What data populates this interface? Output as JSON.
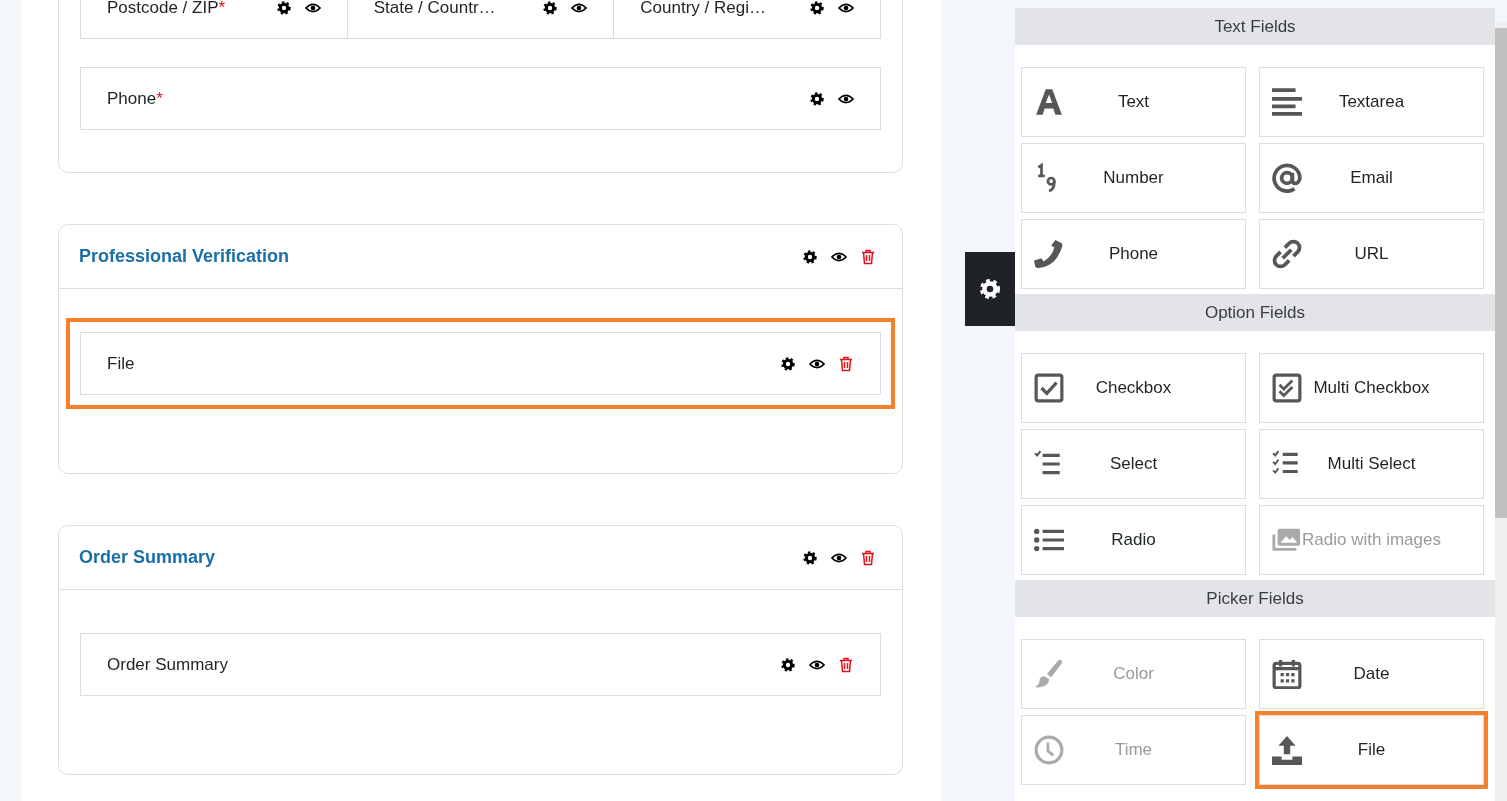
{
  "sections": [
    {
      "rows": [
        {
          "highlighted": false,
          "fields": [
            {
              "label": "Postcode / ZIP",
              "required_mark": "*"
            },
            {
              "label": "State / Countr…"
            },
            {
              "label": "Country / Regi…"
            }
          ]
        },
        {
          "highlighted": false,
          "fields": [
            {
              "label": "Phone",
              "required_mark": "*"
            }
          ]
        }
      ]
    },
    {
      "title": "Professional Verification",
      "deletable": true,
      "rows": [
        {
          "highlighted": true,
          "fields": [
            {
              "label": "File",
              "deletable": true
            }
          ]
        }
      ]
    },
    {
      "title": "Order Summary",
      "deletable": true,
      "rows": [
        {
          "highlighted": false,
          "fields": [
            {
              "label": "Order Summary",
              "deletable": true
            }
          ]
        }
      ]
    }
  ],
  "palette": [
    {
      "title": "Text Fields",
      "items": [
        {
          "kind": "text",
          "label": "Text",
          "disabled": false,
          "highlighted": false
        },
        {
          "kind": "textarea",
          "label": "Textarea",
          "disabled": false,
          "highlighted": false
        },
        {
          "kind": "number",
          "label": "Number",
          "disabled": false,
          "highlighted": false
        },
        {
          "kind": "email",
          "label": "Email",
          "disabled": false,
          "highlighted": false
        },
        {
          "kind": "phone",
          "label": "Phone",
          "disabled": false,
          "highlighted": false
        },
        {
          "kind": "url",
          "label": "URL",
          "disabled": false,
          "highlighted": false
        }
      ]
    },
    {
      "title": "Option Fields",
      "items": [
        {
          "kind": "checkbox",
          "label": "Checkbox",
          "disabled": false,
          "highlighted": false
        },
        {
          "kind": "multi-checkbox",
          "label": "Multi Checkbox",
          "disabled": false,
          "highlighted": false
        },
        {
          "kind": "select",
          "label": "Select",
          "disabled": false,
          "highlighted": false
        },
        {
          "kind": "multi-select",
          "label": "Multi Select",
          "disabled": false,
          "highlighted": false
        },
        {
          "kind": "radio",
          "label": "Radio",
          "disabled": false,
          "highlighted": false
        },
        {
          "kind": "image",
          "label": "Radio with images",
          "disabled": true,
          "highlighted": false
        }
      ]
    },
    {
      "title": "Picker Fields",
      "items": [
        {
          "kind": "color",
          "label": "Color",
          "disabled": true,
          "highlighted": false
        },
        {
          "kind": "date",
          "label": "Date",
          "disabled": false,
          "highlighted": false
        },
        {
          "kind": "time",
          "label": "Time",
          "disabled": true,
          "highlighted": false
        },
        {
          "kind": "file",
          "label": "File",
          "disabled": false,
          "highlighted": true
        }
      ]
    }
  ]
}
